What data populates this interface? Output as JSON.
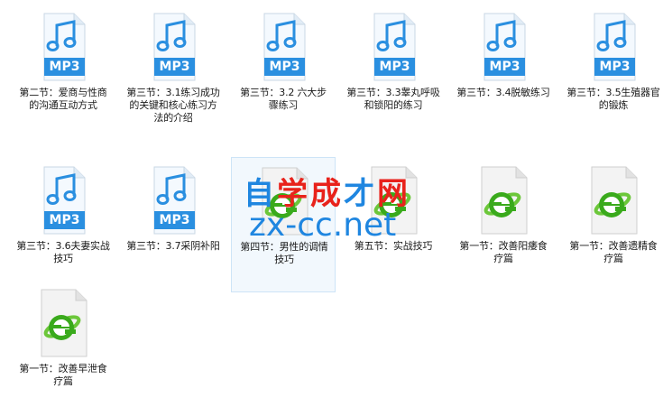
{
  "files": [
    {
      "type": "mp3",
      "label": "第二节：爱商与性商的沟通互动方式"
    },
    {
      "type": "mp3",
      "label": "第三节：3.1练习成功的关键和核心练习方法的介绍"
    },
    {
      "type": "mp3",
      "label": "第三节：3.2 六大步骤练习"
    },
    {
      "type": "mp3",
      "label": "第三节：3.3睾丸呼吸和锁阳的练习"
    },
    {
      "type": "mp3",
      "label": "第三节：3.4脱敏练习"
    },
    {
      "type": "mp3",
      "label": "第三节：3.5生殖器官的锻炼"
    },
    {
      "type": "mp3",
      "label": "第三节：3.6夫妻实战技巧"
    },
    {
      "type": "mp3",
      "label": "第三节：3.7采阴补阳"
    },
    {
      "type": "html",
      "label": "第四节：男性的调情技巧",
      "selected": true
    },
    {
      "type": "html",
      "label": "第五节：实战技巧"
    },
    {
      "type": "html",
      "label": "第一节：改善阳痿食疗篇"
    },
    {
      "type": "html",
      "label": "第一节：改善遗精食疗篇"
    },
    {
      "type": "html",
      "label": "第一节：改善早泄食疗篇"
    }
  ],
  "mp3_badge": "MP3",
  "watermark": {
    "chinese": "自学成才网",
    "url": "zx-cc.net"
  },
  "colors": {
    "mp3_blue": "#2a8fe0",
    "ie_green": "#3aaa1c",
    "wm_red": "#e8221b",
    "wm_blue": "#1f86e0"
  }
}
